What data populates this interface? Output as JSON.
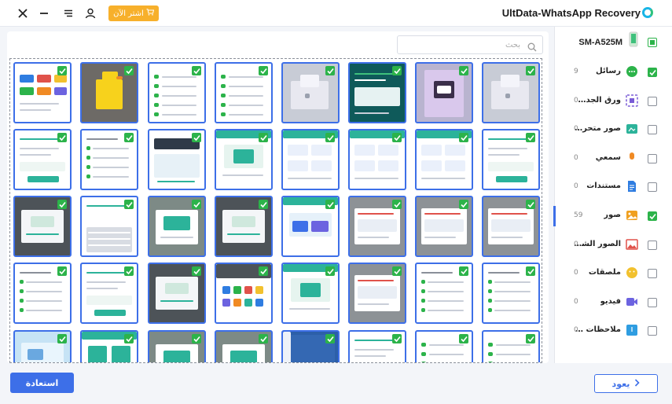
{
  "window": {
    "app_title": "UltData-WhatsApp Recovery",
    "buy_label": "اشتر الآن",
    "icons": [
      "close-icon",
      "minimize-icon",
      "menu-icon",
      "user-icon",
      "cart-icon",
      "app-logo-icon"
    ]
  },
  "search": {
    "placeholder": "بحث"
  },
  "sidebar": {
    "device": "SM-A525M",
    "device_state": "partial",
    "items": [
      {
        "label": "رسائل",
        "count": "9",
        "checked": true,
        "icon": "message-icon",
        "color": "#2cb34a"
      },
      {
        "label": "ورق الجدران",
        "count": "0",
        "checked": false,
        "icon": "wallpaper-icon",
        "color": "#7a5cd6"
      },
      {
        "label": "صور متحركة",
        "count": "0",
        "checked": false,
        "icon": "gif-icon",
        "color": "#2cb39a"
      },
      {
        "label": "سمعي",
        "count": "0",
        "checked": false,
        "icon": "microphone-icon",
        "color": "#f08a24"
      },
      {
        "label": "مستندات",
        "count": "0",
        "checked": false,
        "icon": "document-icon",
        "color": "#2f7de1"
      },
      {
        "label": "صور",
        "count": "59",
        "checked": true,
        "icon": "photo-icon",
        "color": "#f0a020"
      },
      {
        "label": "الصور الشخ...",
        "count": "0",
        "checked": false,
        "icon": "profile-photo-icon",
        "color": "#e0524a"
      },
      {
        "label": "ملصقات",
        "count": "0",
        "checked": false,
        "icon": "sticker-icon",
        "color": "#f2c12e"
      },
      {
        "label": "فيديو",
        "count": "0",
        "checked": false,
        "icon": "video-icon",
        "color": "#6c63e0"
      },
      {
        "label": "ملاحظات صو...",
        "count": "0",
        "checked": false,
        "icon": "voice-note-icon",
        "color": "#2f9de1"
      }
    ]
  },
  "buttons": {
    "restore": "استعادة",
    "back": "يعود"
  },
  "thumbnails": [
    "app-grid",
    "duck",
    "chat-list",
    "chat-list",
    "cartoon",
    "web-page",
    "kuromi-phone",
    "cartoon",
    "form-screen",
    "settings-list",
    "screen-dark",
    "settings-green",
    "card-ui",
    "card-ui",
    "card-ui",
    "form-screen",
    "dark-dialog",
    "keyboard",
    "green-dialog",
    "dark-dialog",
    "wide-page",
    "dialog-screen",
    "dialog-screen",
    "dialog-screen",
    "settings-list",
    "form-screen",
    "dark-dialog",
    "social-icons",
    "settings-green",
    "dialog-screen",
    "settings-list",
    "settings-list",
    "pc-screen",
    "teal-buttons",
    "green-dialog",
    "green-dialog",
    "blue-fabric",
    "form-screen",
    "chat-list",
    "chat-list"
  ]
}
